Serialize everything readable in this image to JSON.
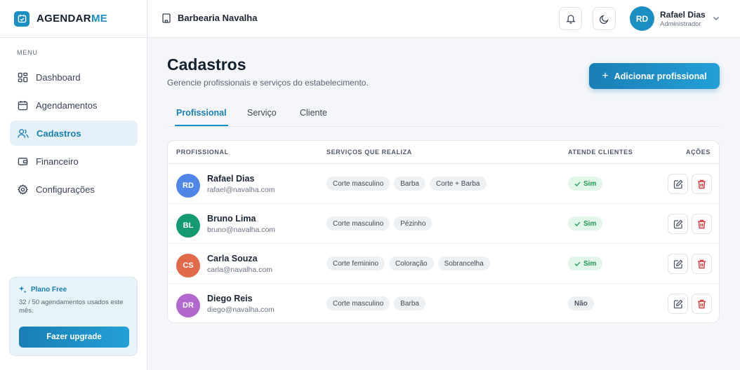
{
  "brand": {
    "name_a": "AGENDAR",
    "name_b": "ME"
  },
  "sidebar": {
    "menu_label": "MENU",
    "items": [
      {
        "label": "Dashboard",
        "icon": "dashboard-icon",
        "active": false
      },
      {
        "label": "Agendamentos",
        "icon": "calendar-icon",
        "active": false
      },
      {
        "label": "Cadastros",
        "icon": "users-icon",
        "active": true
      },
      {
        "label": "Financeiro",
        "icon": "wallet-icon",
        "active": false
      },
      {
        "label": "Configurações",
        "icon": "gear-icon",
        "active": false
      }
    ],
    "plan": {
      "title": "Plano Free",
      "description": "32 / 50 agendamentos usados este mês.",
      "upgrade_label": "Fazer upgrade"
    }
  },
  "header": {
    "business_name": "Barbearia Navalha",
    "user": {
      "initials": "RD",
      "name": "Rafael Dias",
      "role": "Administrador"
    }
  },
  "main": {
    "title": "Cadastros",
    "subtitle": "Gerencie profissionais e serviços do estabelecimento.",
    "add_button_label": "Adicionar profissional",
    "tabs": [
      {
        "label": "Profissional",
        "active": true
      },
      {
        "label": "Serviço",
        "active": false
      },
      {
        "label": "Cliente",
        "active": false
      }
    ],
    "table": {
      "columns": [
        "PROFISSIONAL",
        "SERVIÇOS QUE REALIZA",
        "ATENDE CLIENTES",
        "AÇÕES"
      ],
      "rows": [
        {
          "initials": "RD",
          "avatar_color": "#4f86e8",
          "name": "Rafael Dias",
          "email": "rafael@navalha.com",
          "services": [
            "Corte masculino",
            "Barba",
            "Corte + Barba"
          ],
          "status": "Sim",
          "attends": true
        },
        {
          "initials": "BL",
          "avatar_color": "#139a72",
          "name": "Bruno Lima",
          "email": "bruno@navalha.com",
          "services": [
            "Corte masculino",
            "Pézinho"
          ],
          "status": "Sim",
          "attends": true
        },
        {
          "initials": "CS",
          "avatar_color": "#e06a4a",
          "name": "Carla Souza",
          "email": "carla@navalha.com",
          "services": [
            "Corte feminino",
            "Coloração",
            "Sobrancelha"
          ],
          "status": "Sim",
          "attends": true
        },
        {
          "initials": "DR",
          "avatar_color": "#b269cf",
          "name": "Diego Reis",
          "email": "diego@navalha.com",
          "services": [
            "Corte masculino",
            "Barba"
          ],
          "status": "Não",
          "attends": false
        }
      ]
    }
  },
  "colors": {
    "accent": "#1a8fc4",
    "success": "#1e9a55",
    "danger": "#d93a3a"
  }
}
